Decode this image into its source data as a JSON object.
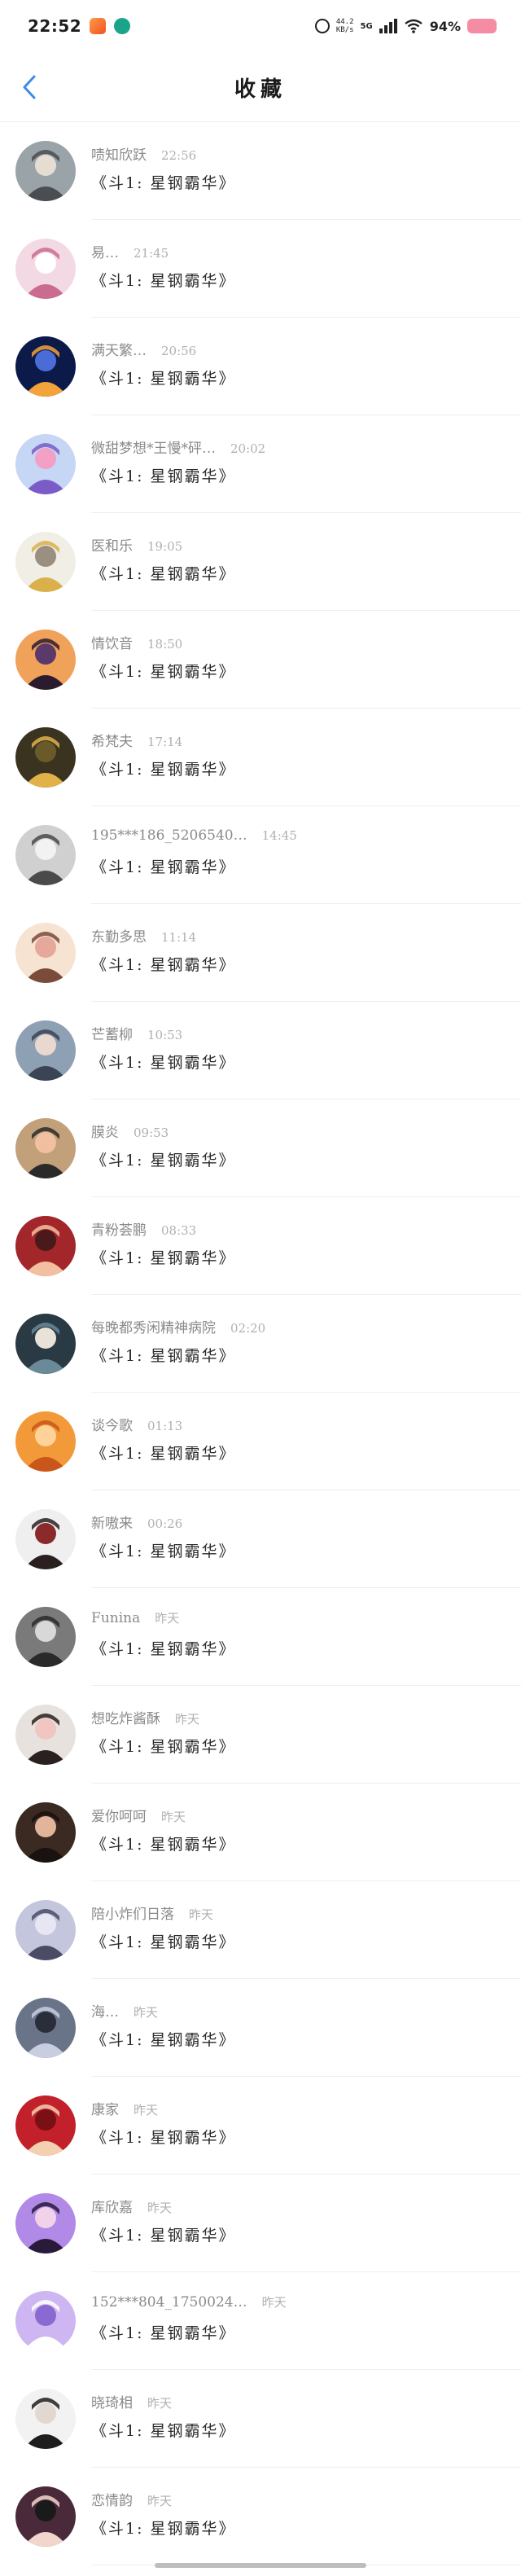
{
  "status_bar": {
    "time": "22:52",
    "speed_top": "44.2",
    "speed_bottom": "KB/s",
    "network": "5G",
    "battery": "94%"
  },
  "header": {
    "title": "收藏",
    "back_icon": "chevron-left-icon",
    "accent_color": "#3a8ee6"
  },
  "items": [
    {
      "nickname": "啧知欣跃",
      "time": "22:56",
      "title": "《斗1: 星钢霸华》"
    },
    {
      "nickname": "易…",
      "time": "21:45",
      "title": "《斗1: 星钢霸华》"
    },
    {
      "nickname": "满天繁…",
      "time": "20:56",
      "title": "《斗1: 星钢霸华》"
    },
    {
      "nickname": "微甜梦想*王慢*砰…",
      "time": "20:02",
      "title": "《斗1: 星钢霸华》"
    },
    {
      "nickname": "医和乐",
      "time": "19:05",
      "title": "《斗1: 星钢霸华》"
    },
    {
      "nickname": "情饮音",
      "time": "18:50",
      "title": "《斗1: 星钢霸华》"
    },
    {
      "nickname": "希梵夫",
      "time": "17:14",
      "title": "《斗1: 星钢霸华》"
    },
    {
      "nickname": "195***186_5206540…",
      "time": "14:45",
      "title": "《斗1: 星钢霸华》"
    },
    {
      "nickname": "东勤多思",
      "time": "11:14",
      "title": "《斗1: 星钢霸华》"
    },
    {
      "nickname": "芒蓄柳",
      "time": "10:53",
      "title": "《斗1: 星钢霸华》"
    },
    {
      "nickname": "膜炎",
      "time": "09:53",
      "title": "《斗1: 星钢霸华》"
    },
    {
      "nickname": "青粉荟鹏",
      "time": "08:33",
      "title": "《斗1: 星钢霸华》"
    },
    {
      "nickname": "每晚都秀闲精神病院",
      "time": "02:20",
      "title": "《斗1: 星钢霸华》"
    },
    {
      "nickname": "谈今歌",
      "time": "01:13",
      "title": "《斗1: 星钢霸华》"
    },
    {
      "nickname": "新嗷来",
      "time": "00:26",
      "title": "《斗1: 星钢霸华》"
    },
    {
      "nickname": "Funina",
      "time": "昨天",
      "title": "《斗1: 星钢霸华》"
    },
    {
      "nickname": "想吃炸酱酥",
      "time": "昨天",
      "title": "《斗1: 星钢霸华》"
    },
    {
      "nickname": "爱你呵呵",
      "time": "昨天",
      "title": "《斗1: 星钢霸华》"
    },
    {
      "nickname": "陪小炸们日落",
      "time": "昨天",
      "title": "《斗1: 星钢霸华》"
    },
    {
      "nickname": "海…",
      "time": "昨天",
      "title": "《斗1: 星钢霸华》"
    },
    {
      "nickname": "康家",
      "time": "昨天",
      "title": "《斗1: 星钢霸华》"
    },
    {
      "nickname": "库欣嘉",
      "time": "昨天",
      "title": "《斗1: 星钢霸华》"
    },
    {
      "nickname": "152***804_1750024…",
      "time": "昨天",
      "title": "《斗1: 星钢霸华》"
    },
    {
      "nickname": "晓琦相",
      "time": "昨天",
      "title": "《斗1: 星钢霸华》"
    },
    {
      "nickname": "恋情韵",
      "time": "昨天",
      "title": "《斗1: 星钢霸华》"
    }
  ],
  "avatars": [
    {
      "bg": "#9aa3a8",
      "fg": "#4a4d52",
      "accent": "#e6ddd2"
    },
    {
      "bg": "#f3d9e4",
      "fg": "#c96c8f",
      "accent": "#ffffff"
    },
    {
      "bg": "#0c1a4a",
      "fg": "#f2a33a",
      "accent": "#4b6bd6"
    },
    {
      "bg": "#c6d6f5",
      "fg": "#7a5cc9",
      "accent": "#f2a0c6"
    },
    {
      "bg": "#f1eee6",
      "fg": "#d9b04a",
      "accent": "#9a8f80"
    },
    {
      "bg": "#f0a15a",
      "fg": "#2a1c2e",
      "accent": "#5a3a6a"
    },
    {
      "bg": "#3a3320",
      "fg": "#e1b14a",
      "accent": "#6a5a2a"
    },
    {
      "bg": "#d0d0d0",
      "fg": "#4a4a4a",
      "accent": "#f2f2f2"
    },
    {
      "bg": "#f6e3d2",
      "fg": "#7a4a3a",
      "accent": "#e6a89a"
    },
    {
      "bg": "#8ea0b4",
      "fg": "#3a4454",
      "accent": "#e9d8d0"
    },
    {
      "bg": "#c2a07a",
      "fg": "#2a2a2a",
      "accent": "#f0c0a0"
    },
    {
      "bg": "#a2262a",
      "fg": "#f2c0a0",
      "accent": "#4a1a1a"
    },
    {
      "bg": "#2a3a44",
      "fg": "#6a8a9a",
      "accent": "#e9e2d8"
    },
    {
      "bg": "#f29a3a",
      "fg": "#c9561a",
      "accent": "#ffd29a"
    },
    {
      "bg": "#efefef",
      "fg": "#2a2020",
      "accent": "#8a2a2a"
    },
    {
      "bg": "#7a7a7a",
      "fg": "#2a2a2a",
      "accent": "#d8d8d8"
    },
    {
      "bg": "#e8e2de",
      "fg": "#2a2020",
      "accent": "#f2c6c0"
    },
    {
      "bg": "#3a2a22",
      "fg": "#1a1210",
      "accent": "#e2b49a"
    },
    {
      "bg": "#c4c6dd",
      "fg": "#4a4c66",
      "accent": "#e8e6f2"
    },
    {
      "bg": "#6a7488",
      "fg": "#c8cde0",
      "accent": "#2a2e3a"
    },
    {
      "bg": "#c2202a",
      "fg": "#f2d0b0",
      "accent": "#7a1015"
    },
    {
      "bg": "#b08ae6",
      "fg": "#2a1a3a",
      "accent": "#f2d2ea"
    },
    {
      "bg": "#cdb6f2",
      "fg": "#ffffff",
      "accent": "#8a6ad0"
    },
    {
      "bg": "#f2f2f2",
      "fg": "#1e1e1e",
      "accent": "#e2d8d2"
    },
    {
      "bg": "#4a2a3a",
      "fg": "#f2d6cc",
      "accent": "#1a1a1a"
    }
  ]
}
